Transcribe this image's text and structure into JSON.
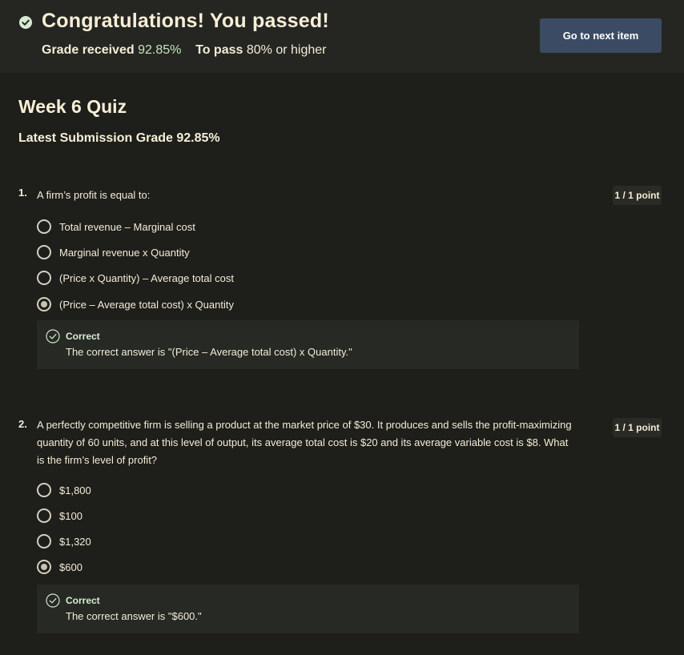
{
  "banner": {
    "title": "Congratulations! You passed!",
    "grade_label": "Grade received",
    "grade_value": "92.85%",
    "pass_label": "To pass",
    "pass_value": "80% or higher",
    "next_button": "Go to next item",
    "icon": "check-circle-icon"
  },
  "quiz": {
    "title": "Week 6 Quiz",
    "latest_submission": "Latest Submission Grade 92.85%"
  },
  "questions": [
    {
      "number": "1.",
      "text": "A firm’s profit is equal to:",
      "points": "1 / 1 point",
      "options": [
        {
          "label": "Total revenue – Marginal cost",
          "selected": false
        },
        {
          "label": "Marginal revenue x Quantity",
          "selected": false
        },
        {
          "label": "(Price x Quantity) – Average total cost",
          "selected": false
        },
        {
          "label": "(Price – Average total cost) x Quantity",
          "selected": true
        }
      ],
      "feedback": {
        "title": "Correct",
        "text": "The correct answer is \"(Price – Average total cost) x Quantity.\""
      }
    },
    {
      "number": "2.",
      "text": "A perfectly competitive firm is selling a product at the market price of $30.  It produces and sells the profit-maximizing quantity of 60 units, and at this level of output, its average total cost is $20 and its average variable cost is $8.  What is the firm’s level of profit?",
      "points": "1 / 1 point",
      "options": [
        {
          "label": "$1,800",
          "selected": false
        },
        {
          "label": "$100",
          "selected": false
        },
        {
          "label": "$1,320",
          "selected": false
        },
        {
          "label": "$600",
          "selected": true
        }
      ],
      "feedback": {
        "title": "Correct",
        "text": "The correct answer is \"$600.\""
      }
    }
  ],
  "colors": {
    "background": "#1e1e1b",
    "banner": "#252622",
    "button": "#3b4b64",
    "grade_value": "#c8e3c0",
    "feedback_bg": "#262924"
  }
}
